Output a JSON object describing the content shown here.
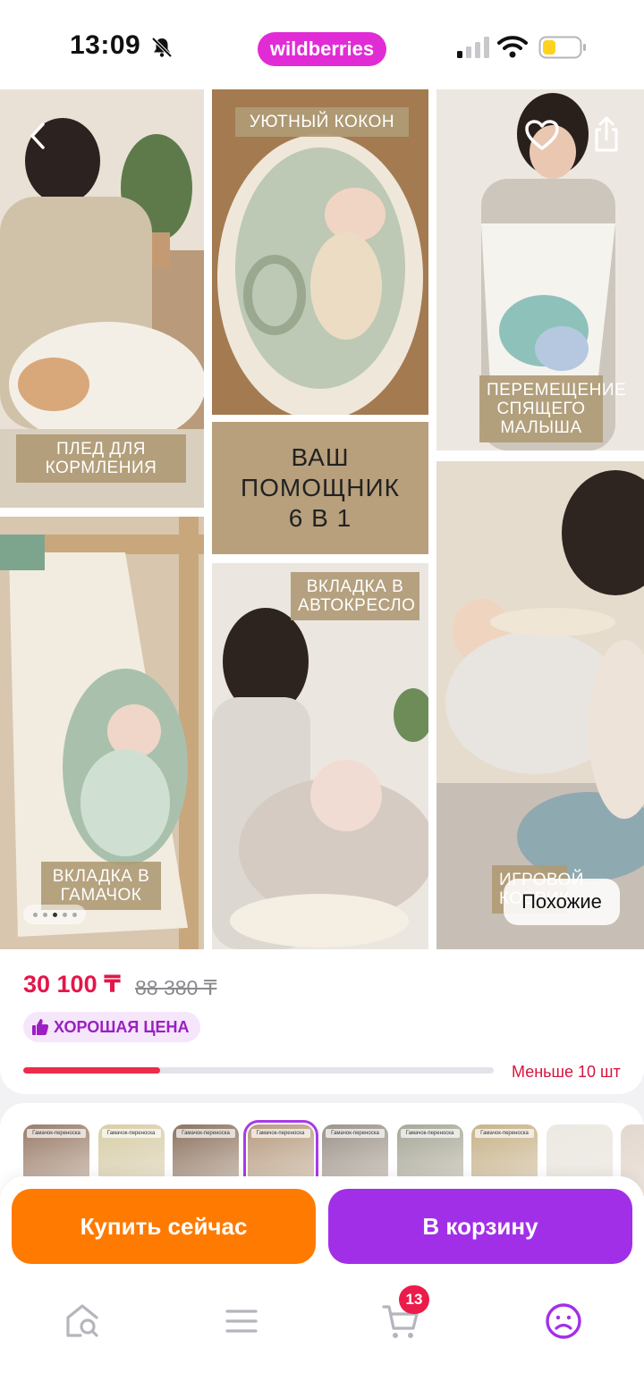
{
  "status_bar": {
    "time": "13:09",
    "brand": "wildberries",
    "battery_color": "#ffd21f"
  },
  "gallery": {
    "captions": {
      "nursing_blanket": "ПЛЕД ДЛЯ КОРМЛЕНИЯ",
      "cozy_cocoon": "УЮТНЫЙ КОКОН",
      "moving_baby": "ПЕРЕМЕЩЕНИЕ СПЯЩЕГО МАЛЫША",
      "helper_title_line1": "ВАШ",
      "helper_title_line2": "ПОМОЩНИК",
      "helper_title_line3": "6 В 1",
      "hammock_insert": "ВКЛАДКА В ГАМАЧОК",
      "car_seat_insert": "ВКЛАДКА В АВТОКРЕСЛО",
      "play_mat": "ИГРОВОЙ КОВРИК"
    },
    "similar_button": "Похожие",
    "page_index": 3,
    "page_count": 5
  },
  "product": {
    "price": "30 100 ₸",
    "old_price": "88 380 ₸",
    "badge": "ХОРОШАЯ ЦЕНА",
    "stock_fraction": 0.29,
    "stock_label": "Меньше 10 шт"
  },
  "variants": {
    "label": "Гамачок-переноска",
    "selected_index": 3,
    "colors": [
      "#9a7d6a",
      "#d8cfa8",
      "#8d7462",
      "#b89d83",
      "#9c948c",
      "#a7a89a",
      "#c8b48a",
      "#ece9e4",
      "#e3d7cf"
    ]
  },
  "actions": {
    "buy_now": "Купить сейчас",
    "add_to_cart": "В корзину"
  },
  "tab_bar": {
    "cart_count": "13",
    "accent": "#a22fe8"
  }
}
